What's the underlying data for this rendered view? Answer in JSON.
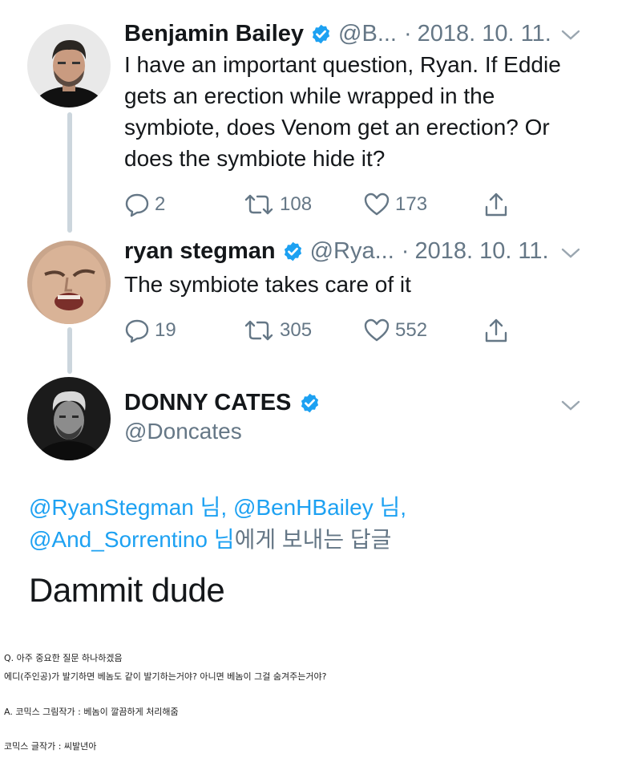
{
  "tweets": [
    {
      "name": "Benjamin Bailey",
      "handle": "@B...",
      "date": "2018. 10. 11.",
      "text": "I have an important question, Ryan. If Eddie gets an erection while wrapped in the symbiote, does Venom get an erection? Or does the symbiote hide it?",
      "replies": "2",
      "retweets": "108",
      "likes": "173"
    },
    {
      "name": "ryan stegman",
      "handle": "@Rya...",
      "date": "2018. 10. 11.",
      "text": "The symbiote takes care of it",
      "replies": "19",
      "retweets": "305",
      "likes": "552"
    }
  ],
  "main_tweet": {
    "name": "DONNY CATES",
    "handle": "@Doncates",
    "reply_mentions": [
      "@RyanStegman",
      "@BenHBailey",
      "@And_Sorrentino"
    ],
    "reply_suffix_1": " 님, ",
    "reply_suffix_2": " 님, ",
    "reply_suffix_3": " 님",
    "reply_tail": "에게 보내는 답글",
    "text": "Dammit dude"
  },
  "captions": {
    "line1": "Q. 아주 중요한 질문 하나하겠음",
    "line2": "에디(주인공)가 발기하면 베놈도 같이 발기하는거야? 아니면 베놈이 그걸 숨겨주는거야?",
    "line3": "A. 코믹스 그림작가 : 베놈이 깔끔하게 처리해줌",
    "line4": "코믹스 글작가 : 씨발년아"
  },
  "colors": {
    "link": "#1da1f2",
    "muted": "#657786",
    "thread_line": "#ccd6dd",
    "verified": "#1da1f2"
  },
  "icons": [
    "reply-icon",
    "retweet-icon",
    "like-icon",
    "share-icon",
    "verified-badge-icon",
    "chevron-down-icon"
  ]
}
